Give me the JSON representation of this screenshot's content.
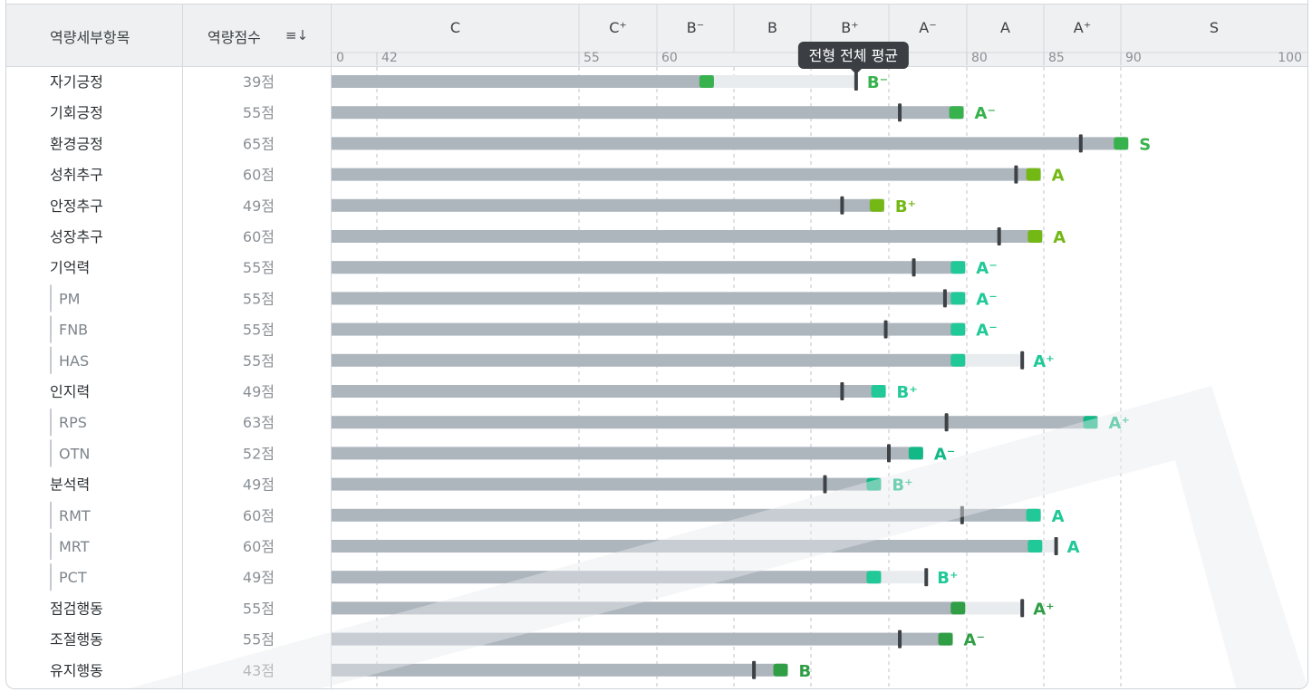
{
  "header": {
    "item_label": "역량세부항목",
    "score_label": "역량점수",
    "sort_icon_glyph": "≡↓"
  },
  "tooltip": {
    "text": "전형 전체 평균"
  },
  "chart_data": {
    "type": "bar",
    "xlim": [
      0,
      100
    ],
    "ticks": [
      0,
      42,
      55,
      60,
      75,
      80,
      85,
      90,
      100
    ],
    "grades": [
      {
        "label": "C",
        "from": 0,
        "to": 55
      },
      {
        "label": "C⁺",
        "from": 55,
        "to": 60
      },
      {
        "label": "B⁻",
        "from": 60,
        "to": 65
      },
      {
        "label": "B",
        "from": 65,
        "to": 70
      },
      {
        "label": "B⁺",
        "from": 70,
        "to": 75
      },
      {
        "label": "A⁻",
        "from": 75,
        "to": 80
      },
      {
        "label": "A",
        "from": 80,
        "to": 85
      },
      {
        "label": "A⁺",
        "from": 85,
        "to": 90
      },
      {
        "label": "S",
        "from": 90,
        "to": 100
      }
    ],
    "rows": [
      {
        "name": "자기긍정",
        "score": "39점",
        "sub": false,
        "value": 63.7,
        "avg": 72.9,
        "grade": "B⁻",
        "color": "#37b24d"
      },
      {
        "name": "기회긍정",
        "score": "55점",
        "sub": false,
        "value": 79.8,
        "avg": 75.7,
        "grade": "A⁻",
        "color": "#37b24d"
      },
      {
        "name": "환경긍정",
        "score": "65점",
        "sub": false,
        "value": 90.4,
        "avg": 87.4,
        "grade": "S",
        "color": "#37b24d"
      },
      {
        "name": "성취추구",
        "score": "60점",
        "sub": false,
        "value": 84.8,
        "avg": 83.2,
        "grade": "A",
        "color": "#74b816"
      },
      {
        "name": "안정추구",
        "score": "49점",
        "sub": false,
        "value": 74.7,
        "avg": 72.0,
        "grade": "B⁺",
        "color": "#74b816"
      },
      {
        "name": "성장추구",
        "score": "60점",
        "sub": false,
        "value": 84.9,
        "avg": 82.1,
        "grade": "A",
        "color": "#74b816"
      },
      {
        "name": "기억력",
        "score": "55점",
        "sub": false,
        "value": 79.9,
        "avg": 76.6,
        "grade": "A⁻",
        "color": "#20c997"
      },
      {
        "name": "PM",
        "score": "55점",
        "sub": true,
        "value": 79.9,
        "avg": 78.6,
        "grade": "A⁻",
        "color": "#20c997"
      },
      {
        "name": "FNB",
        "score": "55점",
        "sub": true,
        "value": 79.9,
        "avg": 74.8,
        "grade": "A⁻",
        "color": "#20c997"
      },
      {
        "name": "HAS",
        "score": "55점",
        "sub": true,
        "value": 79.9,
        "avg": 83.6,
        "grade": "A⁺",
        "color": "#20c997"
      },
      {
        "name": "인지력",
        "score": "49점",
        "sub": false,
        "value": 74.8,
        "avg": 72.0,
        "grade": "B⁺",
        "color": "#20c997"
      },
      {
        "name": "RPS",
        "score": "63점",
        "sub": true,
        "value": 88.5,
        "avg": 78.7,
        "grade": "A⁺",
        "color": "#12b886"
      },
      {
        "name": "OTN",
        "score": "52점",
        "sub": true,
        "value": 77.2,
        "avg": 75.0,
        "grade": "A⁻",
        "color": "#12b886"
      },
      {
        "name": "분석력",
        "score": "49점",
        "sub": false,
        "value": 74.5,
        "avg": 70.9,
        "grade": "B⁺",
        "color": "#12b886"
      },
      {
        "name": "RMT",
        "score": "60점",
        "sub": true,
        "value": 84.8,
        "avg": 79.7,
        "grade": "A",
        "color": "#20c997"
      },
      {
        "name": "MRT",
        "score": "60점",
        "sub": true,
        "value": 84.9,
        "avg": 85.8,
        "grade": "A",
        "color": "#20c997"
      },
      {
        "name": "PCT",
        "score": "49점",
        "sub": true,
        "value": 74.5,
        "avg": 77.4,
        "grade": "B⁺",
        "color": "#20c997"
      },
      {
        "name": "점검행동",
        "score": "55점",
        "sub": false,
        "value": 79.9,
        "avg": 83.6,
        "grade": "A⁺",
        "color": "#2f9e44"
      },
      {
        "name": "조절행동",
        "score": "55점",
        "sub": false,
        "value": 79.1,
        "avg": 75.7,
        "grade": "A⁻",
        "color": "#2f9e44"
      },
      {
        "name": "유지행동",
        "score": "43점",
        "sub": false,
        "value": 68.5,
        "avg": 66.3,
        "grade": "B",
        "color": "#2f9e44"
      }
    ]
  }
}
